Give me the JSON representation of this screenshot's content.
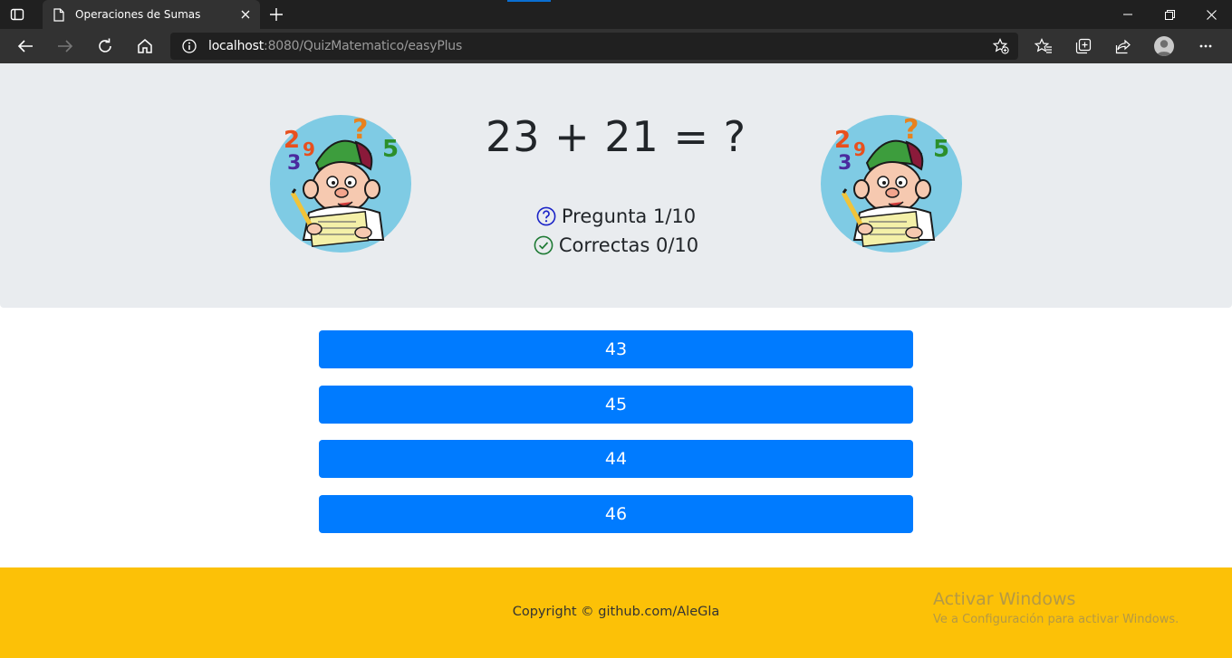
{
  "browser": {
    "tab_title": "Operaciones de Sumas",
    "url_host": "localhost",
    "url_rest": ":8080/QuizMatematico/easyPlus",
    "icons": [
      "tab-actions-icon",
      "page-icon",
      "close-icon",
      "plus-icon",
      "minimize-icon",
      "restore-icon",
      "close-window-icon",
      "back-icon",
      "forward-icon",
      "refresh-icon",
      "home-icon",
      "info-icon",
      "add-favorite-icon",
      "favorites-icon",
      "collections-icon",
      "share-icon",
      "profile-icon",
      "more-icon"
    ]
  },
  "quiz": {
    "question": "23 + 21 = ?",
    "question_label": "Pregunta 1/10",
    "correct_label": "Correctas 0/10",
    "answers": [
      "43",
      "45",
      "44",
      "46"
    ]
  },
  "footer": {
    "copyright": "Copyright © github.com/AleGla"
  },
  "watermark": {
    "title": "Activar Windows",
    "subtitle": "Ve a Configuración para activar Windows."
  },
  "colors": {
    "hero_bg": "#e9ecef",
    "answer_button": "#007bff",
    "footer_bg": "#fcc107",
    "question_icon": "#1a23c7",
    "check_icon": "#1e7a34"
  }
}
